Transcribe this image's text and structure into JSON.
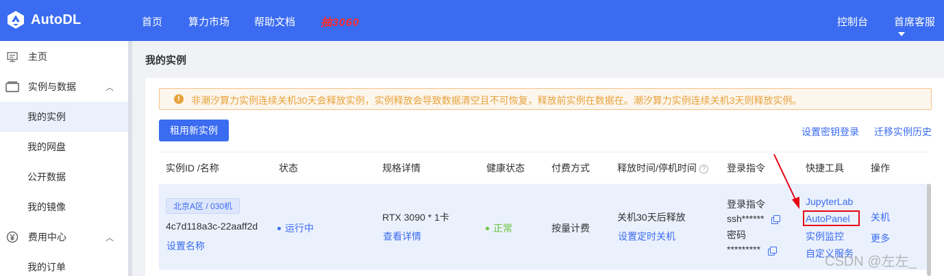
{
  "header": {
    "brand": "AutoDL",
    "nav": [
      "首页",
      "算力市场",
      "帮助文档"
    ],
    "promo": "抽3060",
    "right": {
      "console": "控制台",
      "support": "首席客服"
    },
    "colors": {
      "bar": "#3a6bf0",
      "promo": "#ff2a2a"
    }
  },
  "sidebar": {
    "items": [
      {
        "label": "主页",
        "icon": "home-icon"
      },
      {
        "label": "实例与数据",
        "icon": "instances-icon",
        "expanded": true
      },
      {
        "label": "我的实例",
        "active": true
      },
      {
        "label": "我的网盘"
      },
      {
        "label": "公开数据"
      },
      {
        "label": "我的镜像"
      },
      {
        "label": "费用中心",
        "icon": "yen-icon",
        "expanded": true
      },
      {
        "label": "我的订单"
      }
    ]
  },
  "page": {
    "title": "我的实例",
    "alert": "非潮汐算力实例连续关机30天会释放实例，实例释放会导致数据清空且不可恢复，释放前实例在数据在。潮汐算力实例连续关机3天则释放实例。",
    "rent_button": "租用新实例",
    "links": {
      "ssh_key": "设置密钥登录",
      "migrate": "迁移实例历史"
    }
  },
  "table": {
    "columns": [
      "实例ID /名称",
      "状态",
      "规格详情",
      "健康状态",
      "付费方式",
      "释放时间/停机时间",
      "登录指令",
      "快捷工具",
      "操作"
    ],
    "rows": [
      {
        "region_tag": "北京A区 / 030机",
        "instance_id": "4c7d118a3c-22aaff2d",
        "set_name": "设置名称",
        "status": "运行中",
        "spec": "RTX 3090 * 1卡",
        "spec_detail": "查看详情",
        "health": "正常",
        "billing": "按量计费",
        "release": "关机30天后释放",
        "set_shutdown": "设置定时关机",
        "login_label": "登录指令",
        "login_cmd": "ssh******",
        "password_label": "密码",
        "password": "*********",
        "tools": [
          "JupyterLab",
          "AutoPanel",
          "实例监控",
          "自定义服务"
        ],
        "actions": [
          "关机",
          "更多"
        ]
      }
    ]
  },
  "annotation": {
    "highlight_color": "#e60012"
  },
  "watermark": "CSDN @左左_"
}
